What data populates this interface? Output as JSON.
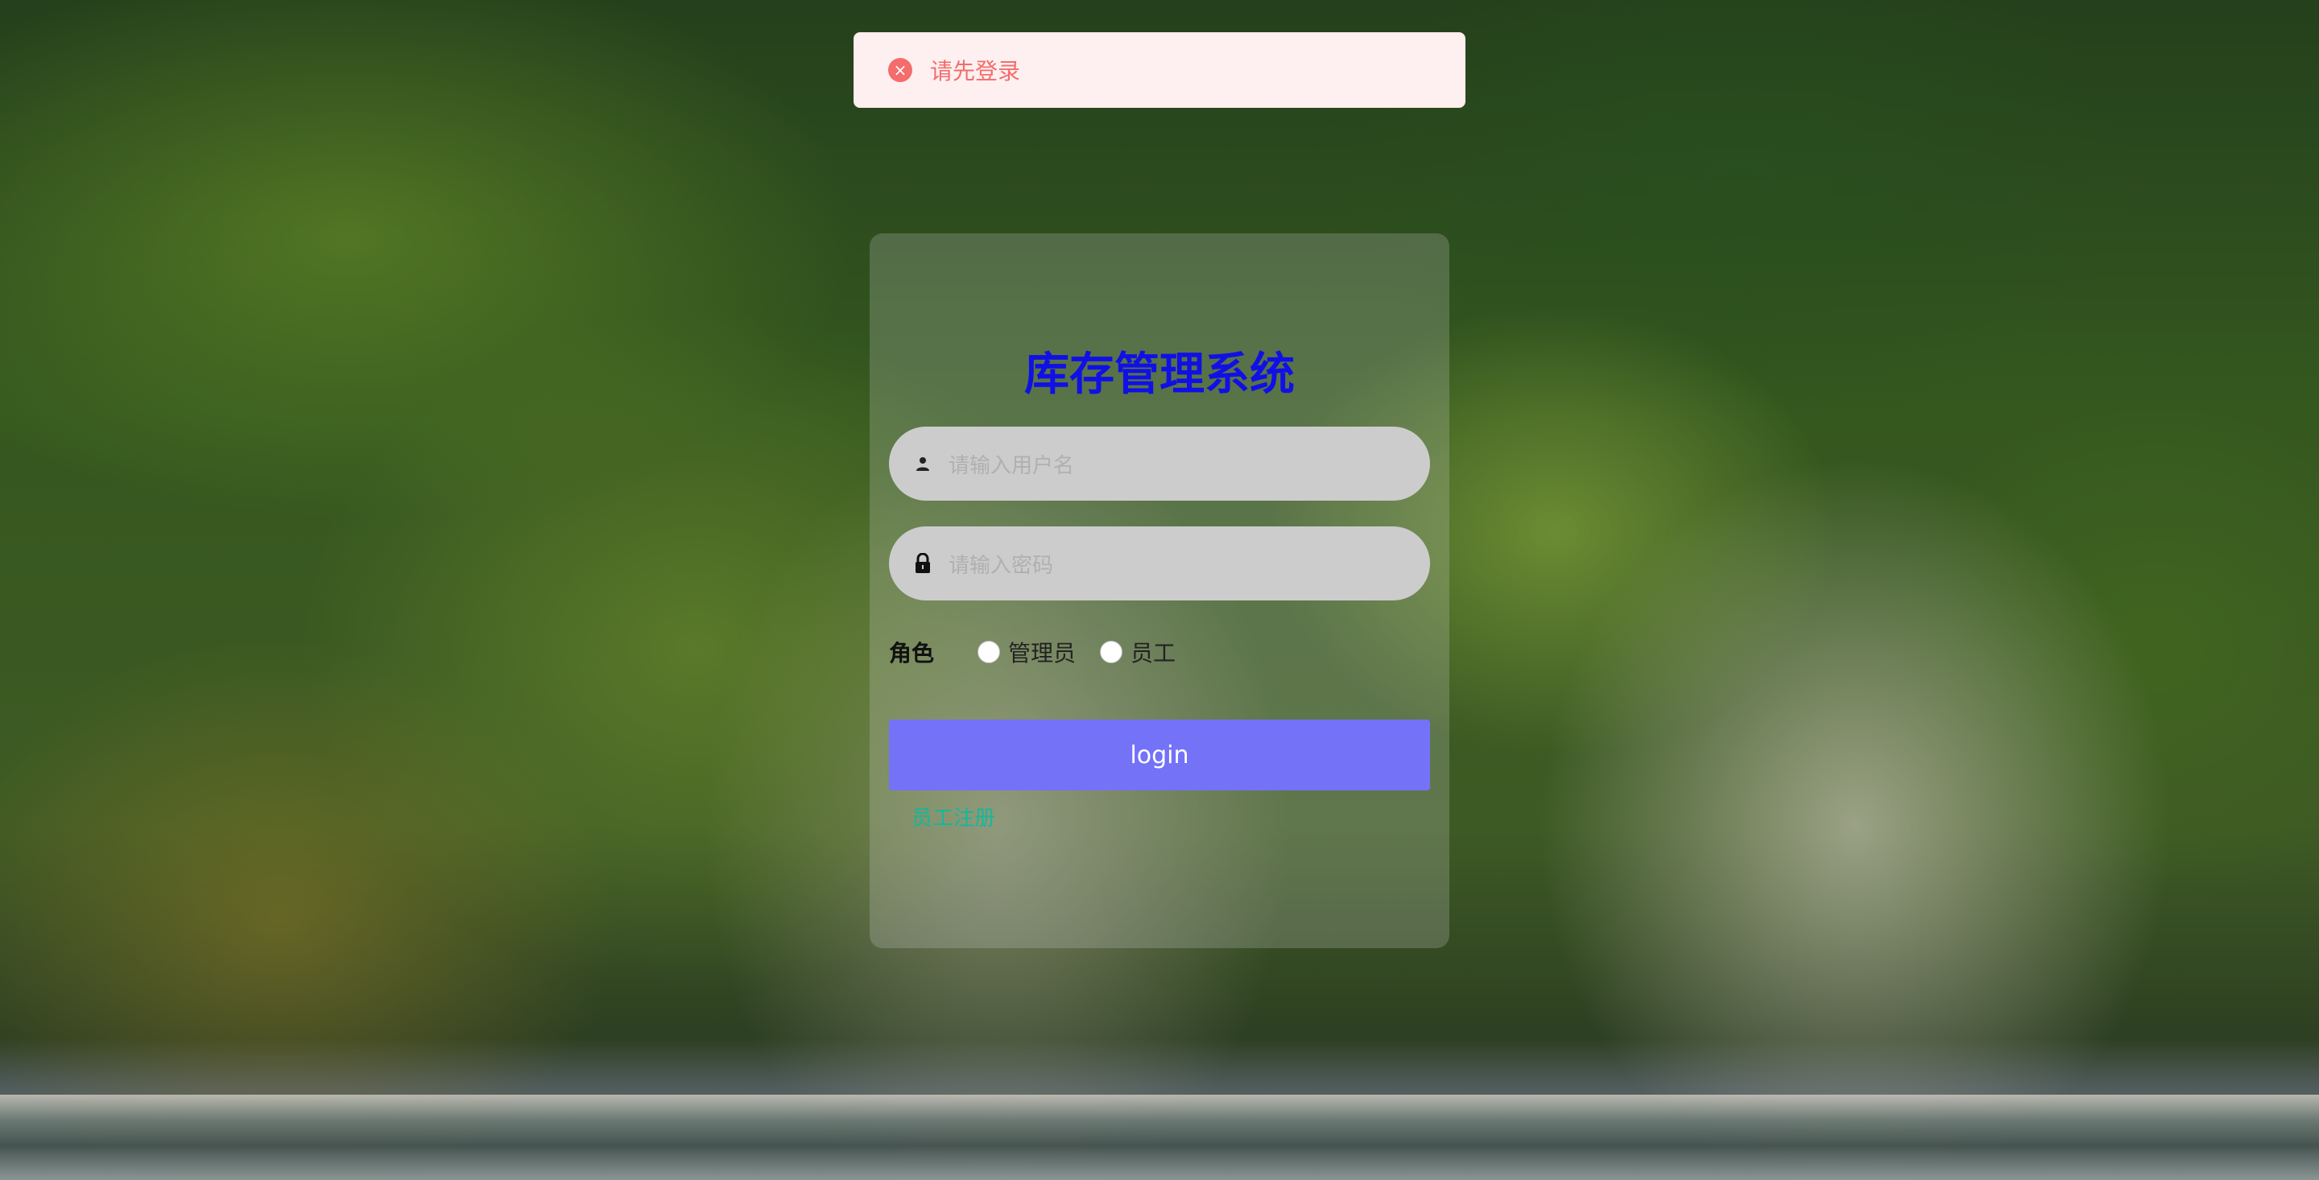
{
  "alert": {
    "icon": "close-circle-icon",
    "message": "请先登录",
    "color": "#f56c6c"
  },
  "login": {
    "title": "库存管理系统",
    "username_placeholder": "请输入用户名",
    "password_placeholder": "请输入密码",
    "role_label": "角色",
    "roles": [
      {
        "label": "管理员",
        "selected": false
      },
      {
        "label": "员工",
        "selected": false
      }
    ],
    "submit_label": "login",
    "register_link": "员工注册",
    "title_color": "#1010e6",
    "button_color": "#7472f7",
    "link_color": "#14b89a"
  }
}
